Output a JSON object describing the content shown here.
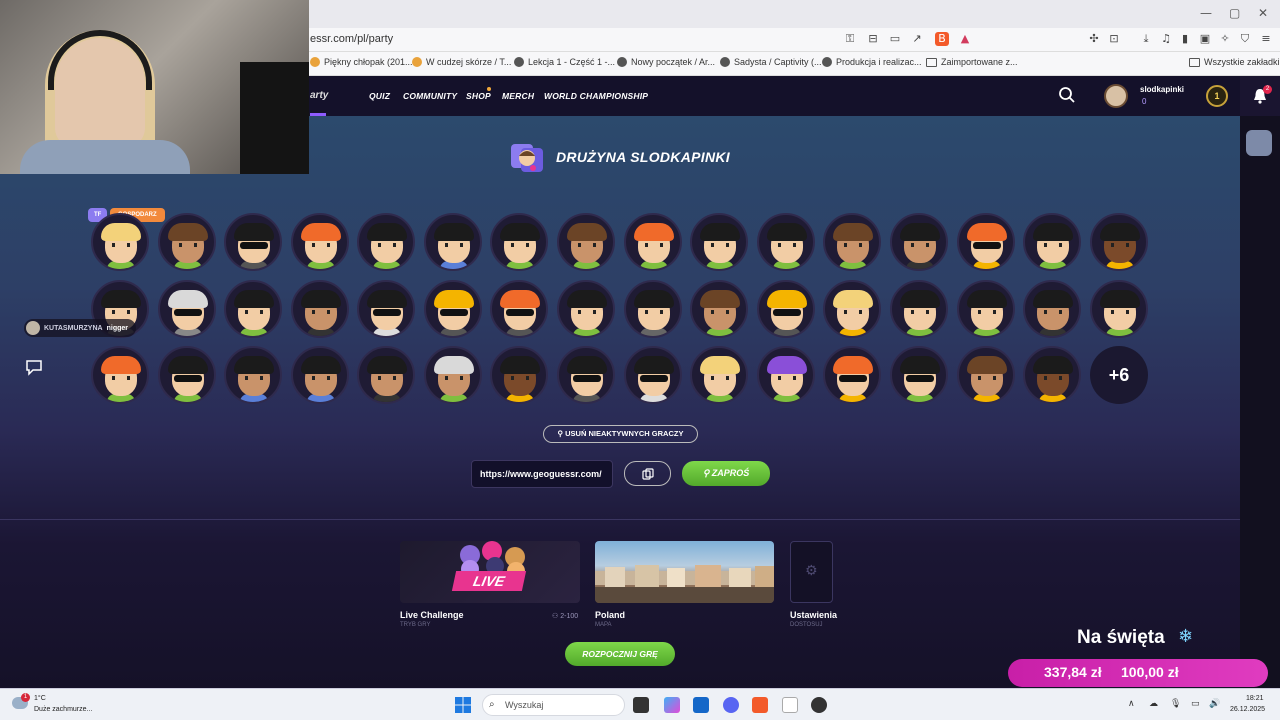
{
  "browser": {
    "url": "essr.com/pl/party",
    "bookmarks": [
      "Piękny chłopak (201...",
      "W cudzej skórze / T...",
      "Lekcja 1 - Część 1 -...",
      "Nowy początek / Ar...",
      "Sadysta / Captivity (...",
      "Produkcja i realizac...",
      "Zaimportowane z...",
      "Wszystkie zakładki"
    ],
    "window_controls": [
      "—",
      "▢",
      "✕"
    ]
  },
  "header": {
    "party_label": "arty",
    "nav": [
      "QUIZ",
      "COMMUNITY",
      "SHOP",
      "MERCH",
      "WORLD CHAMPIONSHIP"
    ],
    "profile": {
      "name": "slodkapinki",
      "coins": "0"
    },
    "level": "1",
    "notifications": "2"
  },
  "team": {
    "title": "DRUŻYNA SLODKAPINKI",
    "badge_tf": "TF",
    "badge_host": "GOSPODARZ",
    "more_count": "+6"
  },
  "avatars": {
    "colors": {
      "skin_light": "#f2cda5",
      "skin_mid": "#c9936a",
      "skin_dark": "#7b4a2a",
      "hair_blond": "#f3d27a",
      "hair_red": "#f06a2a",
      "hair_black": "#1b1b1b",
      "hair_brown": "#6b4426",
      "hair_white": "#d9d9d9",
      "hair_purple": "#8a4fd8",
      "hat_yellow": "#f4b400"
    }
  },
  "controls": {
    "remove_inactive": "USUŃ NIEAKTYWNYCH GRACZY",
    "invite_link": "https://www.geoguessr.com/",
    "invite_button": "ZAPROŚ",
    "start_button": "ROZPOCZNIJ GRĘ"
  },
  "cards": [
    {
      "title": "Live Challenge",
      "subtitle": "TRYB GRY",
      "tag": "LIVE",
      "count": "2-100"
    },
    {
      "title": "Poland",
      "subtitle": "MAPA"
    },
    {
      "title": "Ustawienia",
      "subtitle": "DOSTOSUJ"
    }
  ],
  "overlay": {
    "chat_user": "KUTASMURZYNA",
    "chat_message": "nigger",
    "holiday_text": "Na święta",
    "donation_current": "337,84 zł",
    "donation_goal": "100,00 zł"
  },
  "taskbar": {
    "weather_temp": "1°C",
    "weather_desc": "Duże zachmurze...",
    "weather_badge": "1",
    "search_placeholder": "Wyszukaj",
    "time": "18:21",
    "date": "26.12.2025"
  }
}
